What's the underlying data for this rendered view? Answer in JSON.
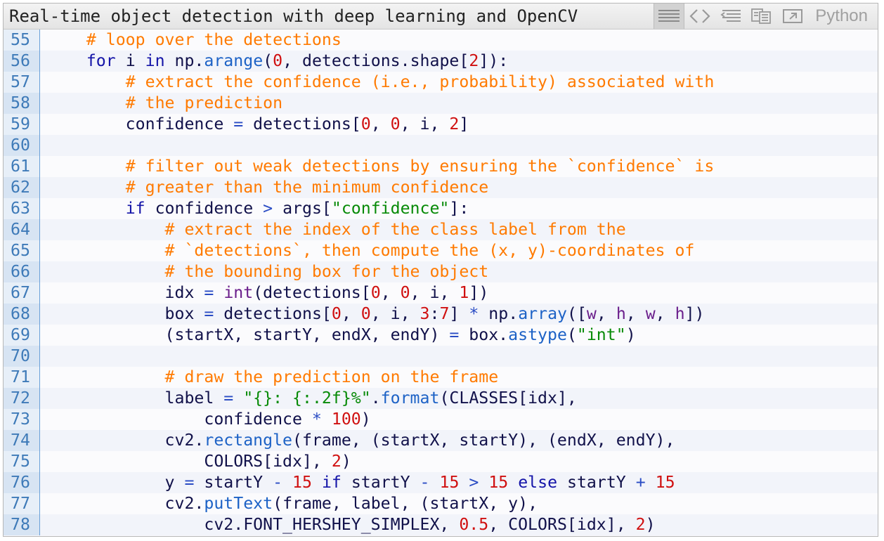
{
  "window": {
    "title": "Real-time object detection with deep learning and OpenCV",
    "language": "Python",
    "toolbar": [
      {
        "name": "view-source-icon",
        "active": true
      },
      {
        "name": "code-brackets-icon",
        "active": false
      },
      {
        "name": "wrap-lines-icon",
        "active": false
      },
      {
        "name": "copy-icon",
        "active": false
      },
      {
        "name": "open-external-icon",
        "active": false
      }
    ]
  },
  "colors": {
    "comment": "#ff7a00",
    "keyword": "#1414a8",
    "number": "#d01010",
    "string": "#078a07",
    "builtin": "#6b1f8c",
    "method": "#1d62c6",
    "line_number": "#3e7ab8"
  },
  "code": {
    "lines": [
      {
        "n": "55",
        "tokens": [
          [
            "t",
            "    "
          ],
          [
            "comment",
            "# loop over the detections"
          ]
        ]
      },
      {
        "n": "56",
        "tokens": [
          [
            "t",
            "    "
          ],
          [
            "keyword",
            "for"
          ],
          [
            "t",
            " i "
          ],
          [
            "keyword",
            "in"
          ],
          [
            "t",
            " np."
          ],
          [
            "method",
            "arange"
          ],
          [
            "t",
            "("
          ],
          [
            "number",
            "0"
          ],
          [
            "t",
            ", detections.shape["
          ],
          [
            "number",
            "2"
          ],
          [
            "t",
            "]):"
          ]
        ]
      },
      {
        "n": "57",
        "tokens": [
          [
            "t",
            "        "
          ],
          [
            "comment",
            "# extract the confidence (i.e., probability) associated with"
          ]
        ]
      },
      {
        "n": "58",
        "tokens": [
          [
            "t",
            "        "
          ],
          [
            "comment",
            "# the prediction"
          ]
        ]
      },
      {
        "n": "59",
        "tokens": [
          [
            "t",
            "        confidence "
          ],
          [
            "operator",
            "="
          ],
          [
            "t",
            " detections["
          ],
          [
            "number",
            "0"
          ],
          [
            "t",
            ", "
          ],
          [
            "number",
            "0"
          ],
          [
            "t",
            ", i, "
          ],
          [
            "number",
            "2"
          ],
          [
            "t",
            "]"
          ]
        ]
      },
      {
        "n": "60",
        "tokens": []
      },
      {
        "n": "61",
        "tokens": [
          [
            "t",
            "        "
          ],
          [
            "comment",
            "# filter out weak detections by ensuring the `confidence` is"
          ]
        ]
      },
      {
        "n": "62",
        "tokens": [
          [
            "t",
            "        "
          ],
          [
            "comment",
            "# greater than the minimum confidence"
          ]
        ]
      },
      {
        "n": "63",
        "tokens": [
          [
            "t",
            "        "
          ],
          [
            "keyword",
            "if"
          ],
          [
            "t",
            " confidence "
          ],
          [
            "operator",
            ">"
          ],
          [
            "t",
            " args["
          ],
          [
            "string",
            "\"confidence\""
          ],
          [
            "t",
            "]:"
          ]
        ]
      },
      {
        "n": "64",
        "tokens": [
          [
            "t",
            "            "
          ],
          [
            "comment",
            "# extract the index of the class label from the"
          ]
        ]
      },
      {
        "n": "65",
        "tokens": [
          [
            "t",
            "            "
          ],
          [
            "comment",
            "# `detections`, then compute the (x, y)-coordinates of"
          ]
        ]
      },
      {
        "n": "66",
        "tokens": [
          [
            "t",
            "            "
          ],
          [
            "comment",
            "# the bounding box for the object"
          ]
        ]
      },
      {
        "n": "67",
        "tokens": [
          [
            "t",
            "            idx "
          ],
          [
            "operator",
            "="
          ],
          [
            "t",
            " "
          ],
          [
            "builtin",
            "int"
          ],
          [
            "t",
            "(detections["
          ],
          [
            "number",
            "0"
          ],
          [
            "t",
            ", "
          ],
          [
            "number",
            "0"
          ],
          [
            "t",
            ", i, "
          ],
          [
            "number",
            "1"
          ],
          [
            "t",
            "])"
          ]
        ]
      },
      {
        "n": "68",
        "tokens": [
          [
            "t",
            "            box "
          ],
          [
            "operator",
            "="
          ],
          [
            "t",
            " detections["
          ],
          [
            "number",
            "0"
          ],
          [
            "t",
            ", "
          ],
          [
            "number",
            "0"
          ],
          [
            "t",
            ", i, "
          ],
          [
            "number",
            "3"
          ],
          [
            "t",
            ":"
          ],
          [
            "number",
            "7"
          ],
          [
            "t",
            "] "
          ],
          [
            "operator",
            "*"
          ],
          [
            "t",
            " np."
          ],
          [
            "method",
            "array"
          ],
          [
            "t",
            "(["
          ],
          [
            "builtin",
            "w"
          ],
          [
            "t",
            ", "
          ],
          [
            "builtin",
            "h"
          ],
          [
            "t",
            ", "
          ],
          [
            "builtin",
            "w"
          ],
          [
            "t",
            ", "
          ],
          [
            "builtin",
            "h"
          ],
          [
            "t",
            "])"
          ]
        ]
      },
      {
        "n": "69",
        "tokens": [
          [
            "t",
            "            (startX, startY, endX, endY) "
          ],
          [
            "operator",
            "="
          ],
          [
            "t",
            " box."
          ],
          [
            "method",
            "astype"
          ],
          [
            "t",
            "("
          ],
          [
            "string",
            "\"int\""
          ],
          [
            "t",
            ")"
          ]
        ]
      },
      {
        "n": "70",
        "tokens": []
      },
      {
        "n": "71",
        "tokens": [
          [
            "t",
            "            "
          ],
          [
            "comment",
            "# draw the prediction on the frame"
          ]
        ]
      },
      {
        "n": "72",
        "tokens": [
          [
            "t",
            "            label "
          ],
          [
            "operator",
            "="
          ],
          [
            "t",
            " "
          ],
          [
            "string",
            "\"{}: {:.2f}%\""
          ],
          [
            "t",
            "."
          ],
          [
            "method",
            "format"
          ],
          [
            "t",
            "(CLASSES[idx],"
          ]
        ]
      },
      {
        "n": "73",
        "tokens": [
          [
            "t",
            "                confidence "
          ],
          [
            "operator",
            "*"
          ],
          [
            "t",
            " "
          ],
          [
            "number",
            "100"
          ],
          [
            "t",
            ")"
          ]
        ]
      },
      {
        "n": "74",
        "tokens": [
          [
            "t",
            "            cv2."
          ],
          [
            "method",
            "rectangle"
          ],
          [
            "t",
            "(frame, (startX, startY), (endX, endY),"
          ]
        ]
      },
      {
        "n": "75",
        "tokens": [
          [
            "t",
            "                COLORS[idx], "
          ],
          [
            "number",
            "2"
          ],
          [
            "t",
            ")"
          ]
        ]
      },
      {
        "n": "76",
        "tokens": [
          [
            "t",
            "            y "
          ],
          [
            "operator",
            "="
          ],
          [
            "t",
            " startY "
          ],
          [
            "operator",
            "-"
          ],
          [
            "t",
            " "
          ],
          [
            "number",
            "15"
          ],
          [
            "t",
            " "
          ],
          [
            "keyword",
            "if"
          ],
          [
            "t",
            " startY "
          ],
          [
            "operator",
            "-"
          ],
          [
            "t",
            " "
          ],
          [
            "number",
            "15"
          ],
          [
            "t",
            " "
          ],
          [
            "operator",
            ">"
          ],
          [
            "t",
            " "
          ],
          [
            "number",
            "15"
          ],
          [
            "t",
            " "
          ],
          [
            "keyword",
            "else"
          ],
          [
            "t",
            " startY "
          ],
          [
            "operator",
            "+"
          ],
          [
            "t",
            " "
          ],
          [
            "number",
            "15"
          ]
        ]
      },
      {
        "n": "77",
        "tokens": [
          [
            "t",
            "            cv2."
          ],
          [
            "method",
            "putText"
          ],
          [
            "t",
            "(frame, label, (startX, y),"
          ]
        ]
      },
      {
        "n": "78",
        "tokens": [
          [
            "t",
            "                cv2.FONT_HERSHEY_SIMPLEX, "
          ],
          [
            "number",
            "0.5"
          ],
          [
            "t",
            ", COLORS[idx], "
          ],
          [
            "number",
            "2"
          ],
          [
            "t",
            ")"
          ]
        ]
      }
    ]
  }
}
